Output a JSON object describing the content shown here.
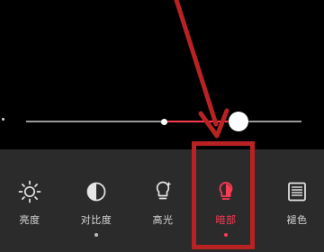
{
  "slider": {
    "value_fraction": 0.77,
    "zero_fraction": 0.5
  },
  "tools": [
    {
      "label": "亮度",
      "icon": "sun-icon",
      "dot": false,
      "active": false
    },
    {
      "label": "对比度",
      "icon": "contrast-icon",
      "dot": true,
      "active": false
    },
    {
      "label": "高光",
      "icon": "lightbulb-sparkle-icon",
      "dot": false,
      "active": false
    },
    {
      "label": "暗部",
      "icon": "half-bulb-icon",
      "dot": true,
      "active": true
    },
    {
      "label": "褪色",
      "icon": "film-icon",
      "dot": false,
      "active": false
    }
  ],
  "colors": {
    "accent": "#ff3a55",
    "annotation": "#b82222",
    "toolbar_bg": "#2b2b2b"
  }
}
